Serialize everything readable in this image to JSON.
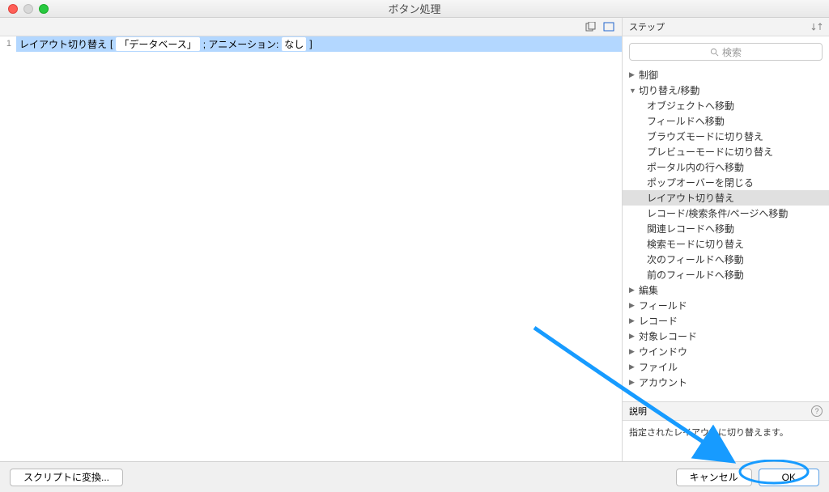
{
  "window": {
    "title": "ボタン処理"
  },
  "leftPane": {
    "line1": {
      "num": "1",
      "cmd": "レイアウト切り替え",
      "layout": "「データベース」",
      "anim_label": "; アニメーション:",
      "anim_value": "なし"
    }
  },
  "rightPane": {
    "header": "ステップ",
    "search_placeholder": "検索",
    "categories": [
      {
        "label": "制御",
        "expanded": false,
        "children": []
      },
      {
        "label": "切り替え/移動",
        "expanded": true,
        "children": [
          "オブジェクトへ移動",
          "フィールドへ移動",
          "ブラウズモードに切り替え",
          "プレビューモードに切り替え",
          "ポータル内の行へ移動",
          "ポップオーバーを閉じる",
          "レイアウト切り替え",
          "レコード/検索条件/ページへ移動",
          "関連レコードへ移動",
          "検索モードに切り替え",
          "次のフィールドへ移動",
          "前のフィールドへ移動"
        ]
      },
      {
        "label": "編集",
        "expanded": false,
        "children": []
      },
      {
        "label": "フィールド",
        "expanded": false,
        "children": []
      },
      {
        "label": "レコード",
        "expanded": false,
        "children": []
      },
      {
        "label": "対象レコード",
        "expanded": false,
        "children": []
      },
      {
        "label": "ウインドウ",
        "expanded": false,
        "children": []
      },
      {
        "label": "ファイル",
        "expanded": false,
        "children": []
      },
      {
        "label": "アカウント",
        "expanded": false,
        "children": []
      }
    ],
    "selected_child": "レイアウト切り替え",
    "desc_header": "説明",
    "desc_body": "指定されたレイアウトに切り替えます。"
  },
  "footer": {
    "convert": "スクリプトに変換...",
    "cancel": "キャンセル",
    "ok": "OK"
  }
}
